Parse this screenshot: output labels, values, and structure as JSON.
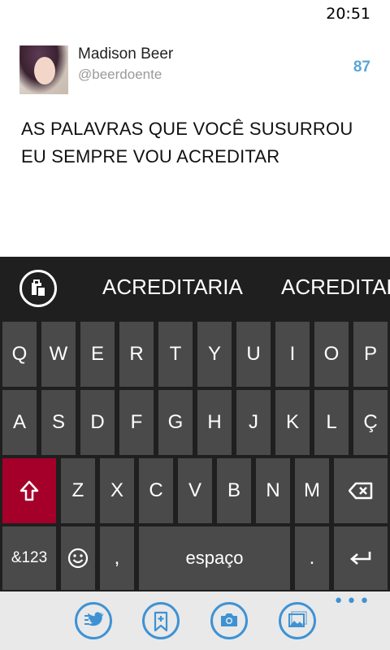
{
  "status_bar": {
    "time": "20:51"
  },
  "compose": {
    "user_name": "Madison Beer",
    "user_handle": "@beerdoente",
    "remaining_chars": "87",
    "tweet_text": "AS PALAVRAS QUE VOCÊ SUSURROU EU SEMPRE VOU ACREDITAR"
  },
  "keyboard": {
    "suggestions": [
      "ACREDITARIA",
      "ACREDITAR"
    ],
    "row1": [
      "Q",
      "W",
      "E",
      "R",
      "T",
      "Y",
      "U",
      "I",
      "O",
      "P"
    ],
    "row2": [
      "A",
      "S",
      "D",
      "F",
      "G",
      "H",
      "J",
      "K",
      "L",
      "Ç"
    ],
    "row3": [
      "Z",
      "X",
      "C",
      "V",
      "B",
      "N",
      "M"
    ],
    "numbers_label": "&123",
    "comma_label": ",",
    "space_label": "espaço",
    "period_label": ".",
    "shift_color": "#a4002a"
  },
  "app_bar": {
    "buttons": [
      "twitter-compose-icon",
      "add-tag-icon",
      "camera-icon",
      "gallery-icon"
    ],
    "more": "•••"
  }
}
